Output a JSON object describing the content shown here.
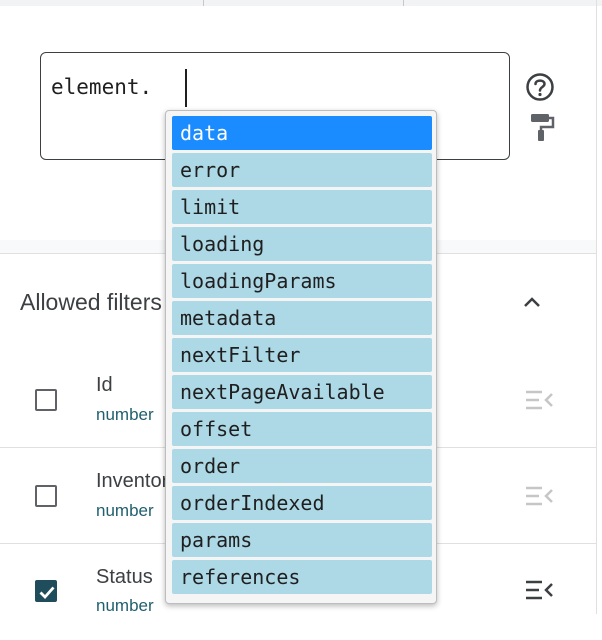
{
  "editor": {
    "value": "element."
  },
  "autocomplete": {
    "items": [
      {
        "label": "data",
        "selected": true
      },
      {
        "label": "error",
        "selected": false
      },
      {
        "label": "limit",
        "selected": false
      },
      {
        "label": "loading",
        "selected": false
      },
      {
        "label": "loadingParams",
        "selected": false
      },
      {
        "label": "metadata",
        "selected": false
      },
      {
        "label": "nextFilter",
        "selected": false
      },
      {
        "label": "nextPageAvailable",
        "selected": false
      },
      {
        "label": "offset",
        "selected": false
      },
      {
        "label": "order",
        "selected": false
      },
      {
        "label": "orderIndexed",
        "selected": false
      },
      {
        "label": "params",
        "selected": false
      },
      {
        "label": "references",
        "selected": false
      }
    ]
  },
  "icons": {
    "help": "help-circle-icon",
    "format": "paint-roller-icon",
    "collapse": "chevron-up-icon",
    "reorder": "reorder-icon",
    "check": "check-icon"
  },
  "filters": {
    "title": "Allowed filters",
    "rows": [
      {
        "name": "Id",
        "type": "number",
        "checked": false
      },
      {
        "name": "Inventory",
        "type": "number",
        "checked": false
      },
      {
        "name": "Status",
        "type": "number",
        "checked": true
      }
    ]
  },
  "colors": {
    "selected_item": "#1a8cff",
    "item_background": "#add8e6",
    "checked_box": "#1f4d5c",
    "type_text": "#1f5f6e"
  }
}
